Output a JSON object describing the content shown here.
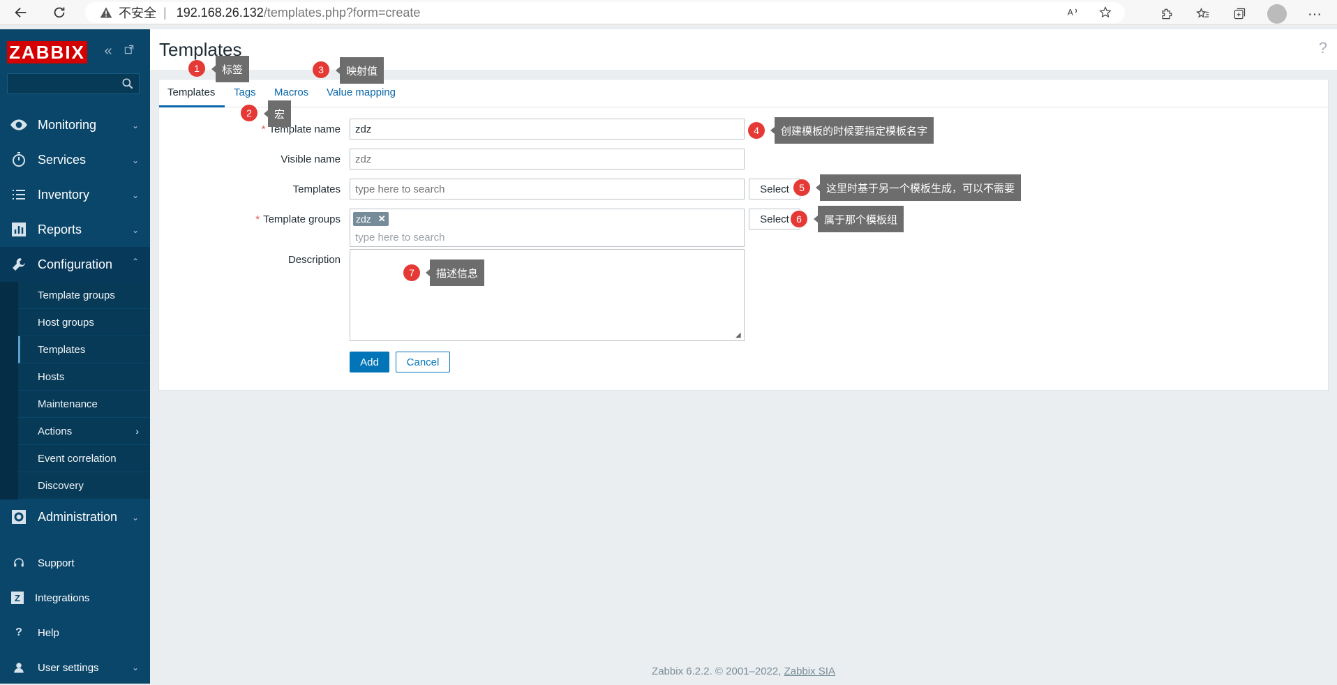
{
  "browser": {
    "insecure_label": "不安全",
    "separator": "|",
    "url_host": "192.168.26.132",
    "url_path": "/templates.php?form=create"
  },
  "sidebar": {
    "logo": "ZABBIX",
    "search_placeholder": "",
    "menu": [
      {
        "label": "Monitoring",
        "icon": "eye-icon"
      },
      {
        "label": "Services",
        "icon": "stopwatch-icon"
      },
      {
        "label": "Inventory",
        "icon": "list-icon"
      },
      {
        "label": "Reports",
        "icon": "bar-chart-icon"
      },
      {
        "label": "Configuration",
        "icon": "wrench-icon"
      }
    ],
    "config_submenu": [
      "Template groups",
      "Host groups",
      "Templates",
      "Hosts",
      "Maintenance",
      "Actions",
      "Event correlation",
      "Discovery"
    ],
    "administration": "Administration",
    "bottom": [
      "Support",
      "Integrations",
      "Help",
      "User settings"
    ]
  },
  "header": {
    "title": "Templates",
    "help": "?"
  },
  "tabs": [
    "Templates",
    "Tags",
    "Macros",
    "Value mapping"
  ],
  "form": {
    "template_name_label": "Template name",
    "template_name_value": "zdz",
    "visible_name_label": "Visible name",
    "visible_name_placeholder": "zdz",
    "templates_label": "Templates",
    "templates_placeholder": "type here to search",
    "select_label": "Select",
    "template_groups_label": "Template groups",
    "template_groups_chip": "zdz",
    "template_groups_placeholder": "type here to search",
    "description_label": "Description",
    "add_label": "Add",
    "cancel_label": "Cancel"
  },
  "footer": {
    "text": "Zabbix 6.2.2. © 2001–2022, ",
    "link": "Zabbix SIA"
  },
  "annotations": [
    {
      "num": "1",
      "text": "标签"
    },
    {
      "num": "2",
      "text": "宏"
    },
    {
      "num": "3",
      "text": "映射值"
    },
    {
      "num": "4",
      "text": "创建模板的时候要指定模板名字"
    },
    {
      "num": "5",
      "text": "这里时基于另一个模板生成，可以不需要"
    },
    {
      "num": "6",
      "text": "属于那个模板组"
    },
    {
      "num": "7",
      "text": "描述信息"
    }
  ],
  "colors": {
    "sidebar_bg": "#0a466a",
    "accent": "#0275b8",
    "logo_red": "#d40000",
    "annotation_red": "#e53935",
    "required": "#e45959"
  }
}
